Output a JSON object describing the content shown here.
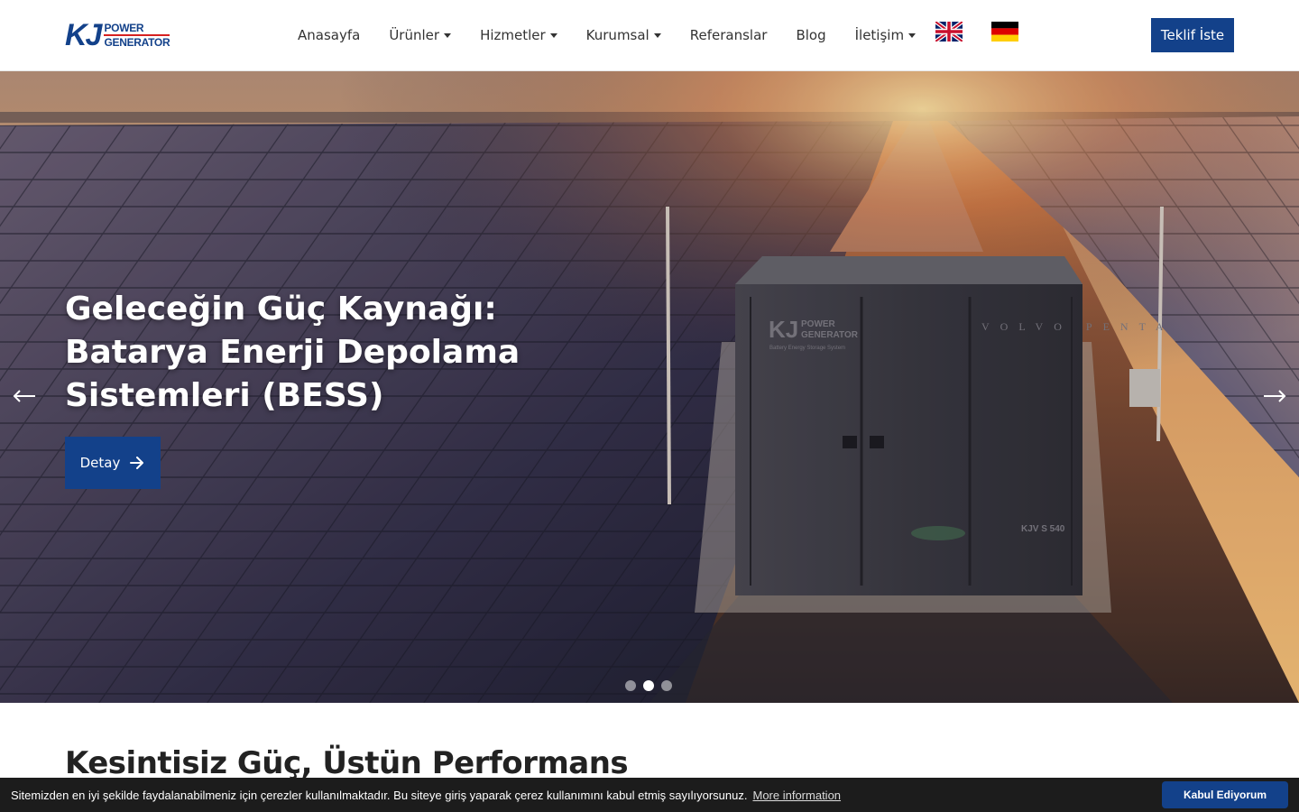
{
  "header": {
    "logo": {
      "mark": "KJ",
      "line1": "POWER",
      "line2": "GENERATOR"
    },
    "nav": [
      {
        "label": "Anasayfa",
        "dropdown": false
      },
      {
        "label": "Ürünler",
        "dropdown": true
      },
      {
        "label": "Hizmetler",
        "dropdown": true
      },
      {
        "label": "Kurumsal",
        "dropdown": true
      },
      {
        "label": "Referanslar",
        "dropdown": false
      },
      {
        "label": "Blog",
        "dropdown": false
      },
      {
        "label": "İletişim",
        "dropdown": true
      }
    ],
    "languages": [
      {
        "icon": "uk-flag-icon"
      },
      {
        "icon": "germany-flag-icon"
      }
    ],
    "cta_label": "Teklif İste"
  },
  "hero": {
    "title": "Geleceğin Güç Kaynağı: Batarya Enerji Depolama Sistemleri (BESS)",
    "button_label": "Detay",
    "button_icon": "arrow-right-icon",
    "slide_count": 3,
    "active_slide": 2,
    "container_brand": {
      "line1": "POWER",
      "line2": "GENERATOR",
      "caption": "Battery Energy Storage System",
      "engine": "VOLVO PENTA",
      "model": "KJV S 540"
    }
  },
  "section": {
    "title": "Kesintisiz Güç, Üstün Performans"
  },
  "cookie": {
    "text": "Sitemizden en iyi şekilde faydalanabilmeniz için çerezler kullanılmaktadır. Bu siteye giriş yaparak çerez kullanımını kabul etmiş sayılıyorsunuz.",
    "link_label": "More information",
    "accept_label": "Kabul Ediyorum"
  },
  "colors": {
    "brand_blue": "#13418a",
    "logo_red": "#d62020",
    "cookie_bg": "#1c1c1c"
  }
}
